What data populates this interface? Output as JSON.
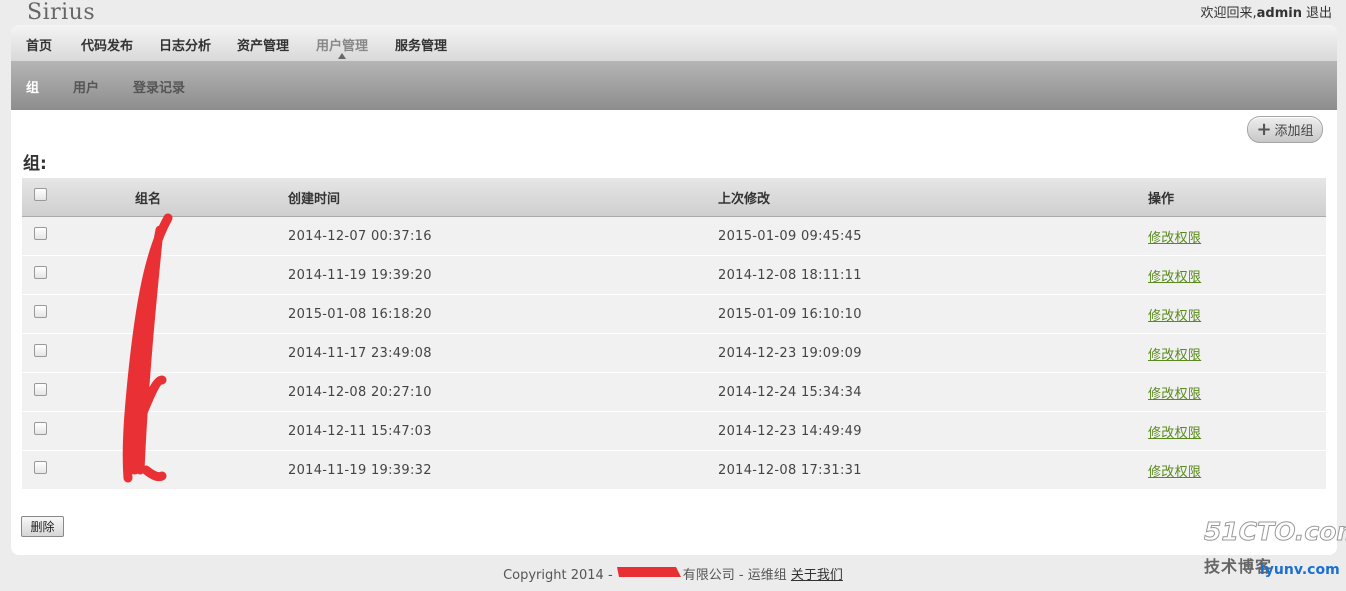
{
  "brand": "Sirius",
  "userbar": {
    "greeting": "欢迎回来,",
    "username": "admin",
    "logout": "退出"
  },
  "topnav": [
    "首页",
    "代码发布",
    "日志分析",
    "资产管理",
    "用户管理",
    "服务管理"
  ],
  "topnav_active": "用户管理",
  "subnav": [
    "组",
    "用户",
    "登录记录"
  ],
  "subnav_active": "组",
  "add_button": "添加组",
  "add_icon": "plus-icon",
  "section_title": "组:",
  "table": {
    "headers": [
      "",
      "组名",
      "创建时间",
      "上次修改",
      "操作"
    ],
    "rows": [
      {
        "name": "",
        "created": "2014-12-07 00:37:16",
        "modified": "2015-01-09 09:45:45",
        "action": "修改权限"
      },
      {
        "name": "",
        "created": "2014-11-19 19:39:20",
        "modified": "2014-12-08 18:11:11",
        "action": "修改权限"
      },
      {
        "name": "",
        "created": "2015-01-08 16:18:20",
        "modified": "2015-01-09 16:10:10",
        "action": "修改权限"
      },
      {
        "name": "",
        "created": "2014-11-17 23:49:08",
        "modified": "2014-12-23 19:09:09",
        "action": "修改权限"
      },
      {
        "name": "",
        "created": "2014-12-08 20:27:10",
        "modified": "2014-12-24 15:34:34",
        "action": "修改权限"
      },
      {
        "name": "",
        "created": "2014-12-11 15:47:03",
        "modified": "2014-12-23 14:49:49",
        "action": "修改权限"
      },
      {
        "name": "",
        "created": "2014-11-19 19:39:32",
        "modified": "2014-12-08 17:31:31",
        "action": "修改权限"
      }
    ]
  },
  "delete_button": "删除",
  "footer": {
    "prefix": "Copyright 2014 - ",
    "company": "有限公司",
    "middle": " - 运维组 ",
    "about": "关于我们"
  },
  "watermark": {
    "site": "51CTO.com",
    "sub": "技术博客",
    "iyunv": "iyunv.com"
  },
  "colors": {
    "link": "#5a8a1e",
    "redaction": "#e8262a"
  }
}
